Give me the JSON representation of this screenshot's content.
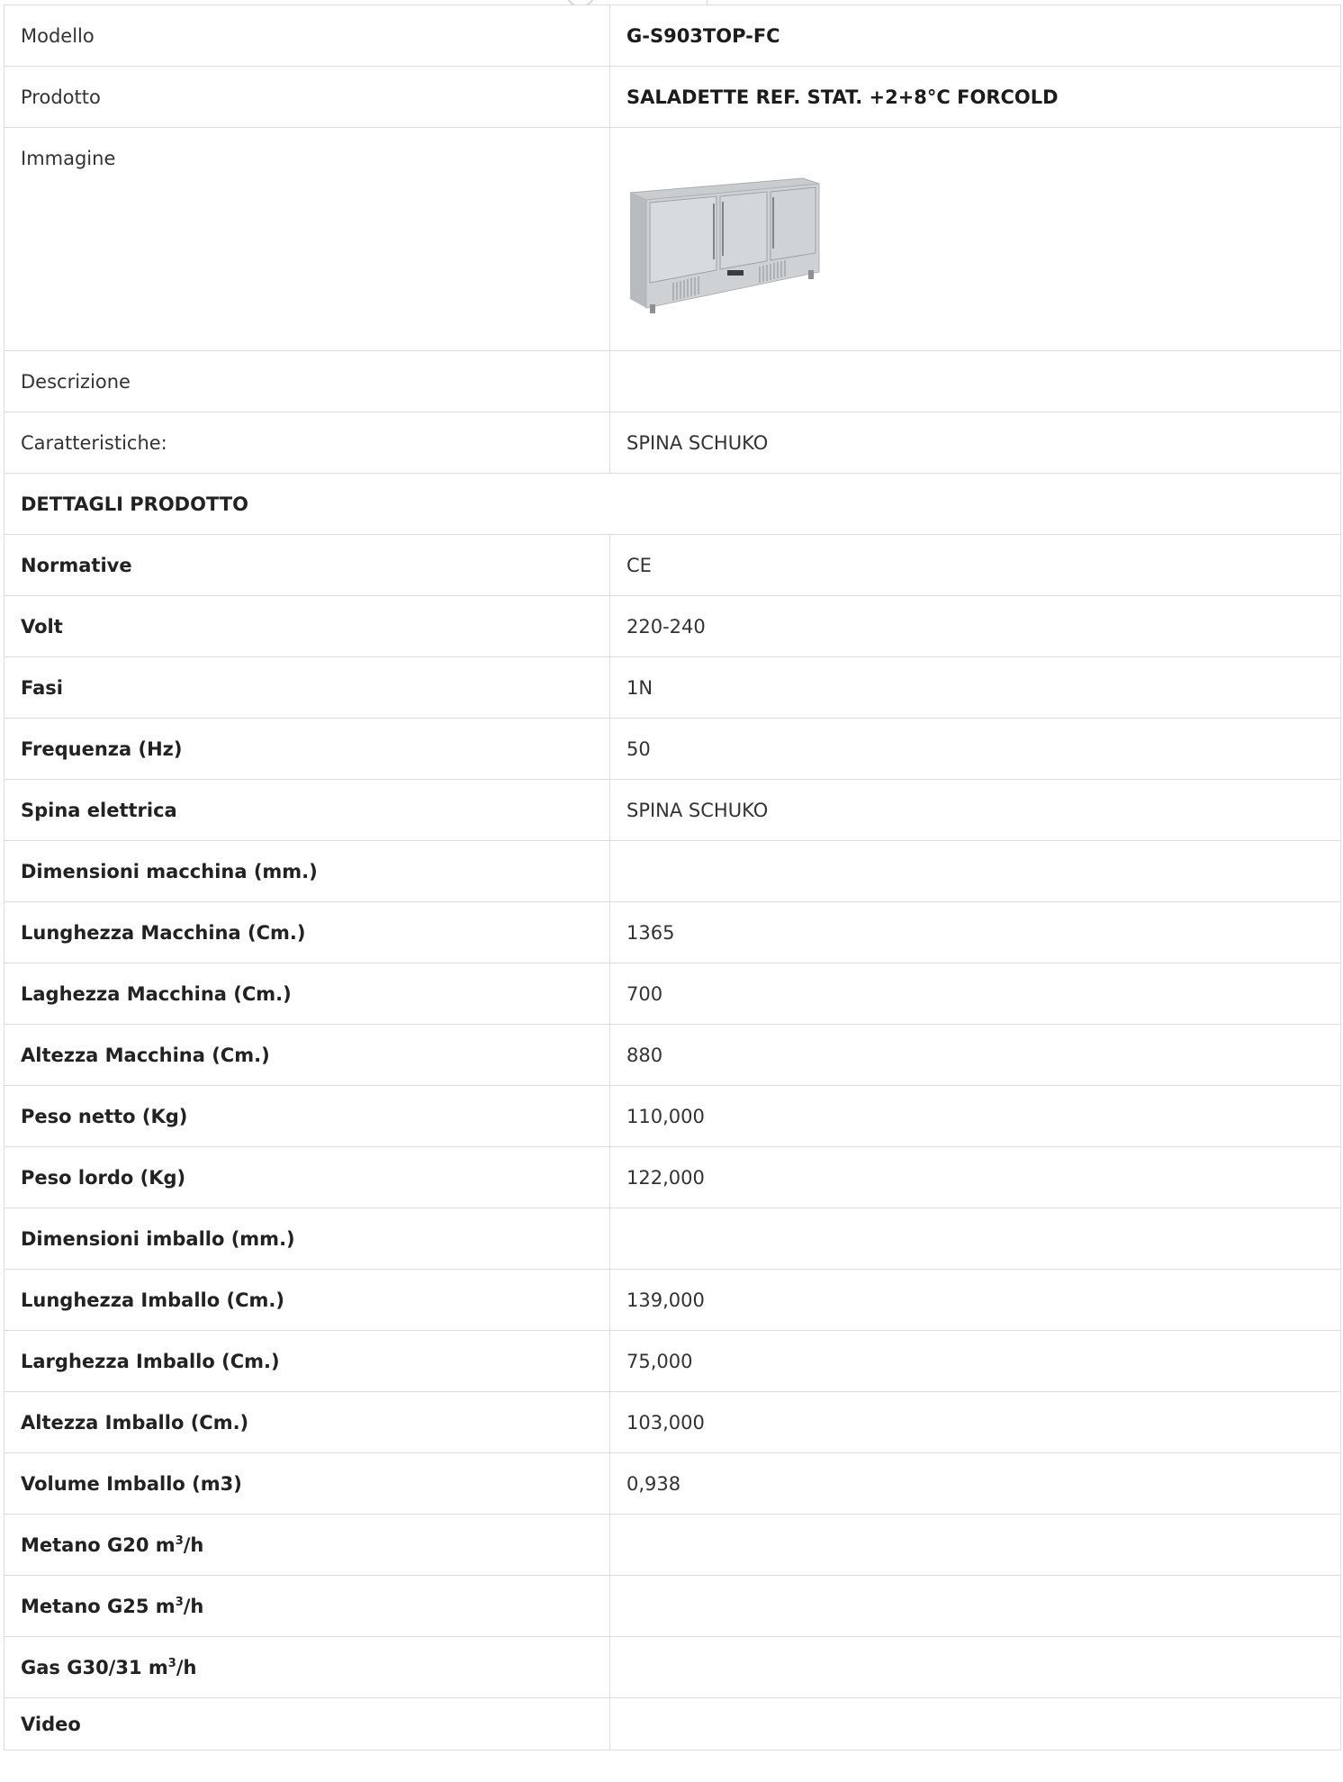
{
  "rows": [
    {
      "label": "Modello",
      "value": "G-S903TOP-FC",
      "label_bold": false,
      "value_bold": true
    },
    {
      "label": "Prodotto",
      "value": "SALADETTE REF. STAT. +2+8°C FORCOLD",
      "label_bold": false,
      "value_bold": true
    }
  ],
  "image_row": {
    "label": "Immagine",
    "image_icon": "saladette-counter-3-doors-icon"
  },
  "rows2": [
    {
      "label": "Descrizione",
      "value": ""
    },
    {
      "label": "Caratteristiche:",
      "value": "SPINA SCHUKO"
    }
  ],
  "section_title": "DETTAGLI PRODOTTO",
  "details": [
    {
      "label": "Normative",
      "value": "CE"
    },
    {
      "label": "Volt",
      "value": "220-240"
    },
    {
      "label": "Fasi",
      "value": "1N"
    },
    {
      "label": "Frequenza (Hz)",
      "value": "50"
    },
    {
      "label": "Spina elettrica",
      "value": "SPINA SCHUKO"
    },
    {
      "label": "Dimensioni macchina (mm.)",
      "value": ""
    },
    {
      "label": "Lunghezza Macchina (Cm.)",
      "value": "1365"
    },
    {
      "label": "Laghezza Macchina (Cm.)",
      "value": "700"
    },
    {
      "label": "Altezza Macchina (Cm.)",
      "value": "880"
    },
    {
      "label": "Peso netto (Kg)",
      "value": "110,000"
    },
    {
      "label": "Peso lordo (Kg)",
      "value": "122,000"
    },
    {
      "label": "Dimensioni imballo (mm.)",
      "value": ""
    },
    {
      "label": "Lunghezza Imballo (Cm.)",
      "value": "139,000"
    },
    {
      "label": "Larghezza Imballo (Cm.)",
      "value": "75,000"
    },
    {
      "label": "Altezza Imballo (Cm.)",
      "value": "103,000"
    },
    {
      "label": "Volume Imballo (m3)",
      "value": "0,938"
    }
  ],
  "gas_rows": [
    {
      "label_pre": "Metano G20 m",
      "sup": "3",
      "label_post": "/h",
      "value": ""
    },
    {
      "label_pre": "Metano G25 m",
      "sup": "3",
      "label_post": "/h",
      "value": ""
    },
    {
      "label_pre": "Gas G30/31 m",
      "sup": "3",
      "label_post": "/h",
      "value": ""
    }
  ],
  "video_row": {
    "label": "Video",
    "value": ""
  }
}
